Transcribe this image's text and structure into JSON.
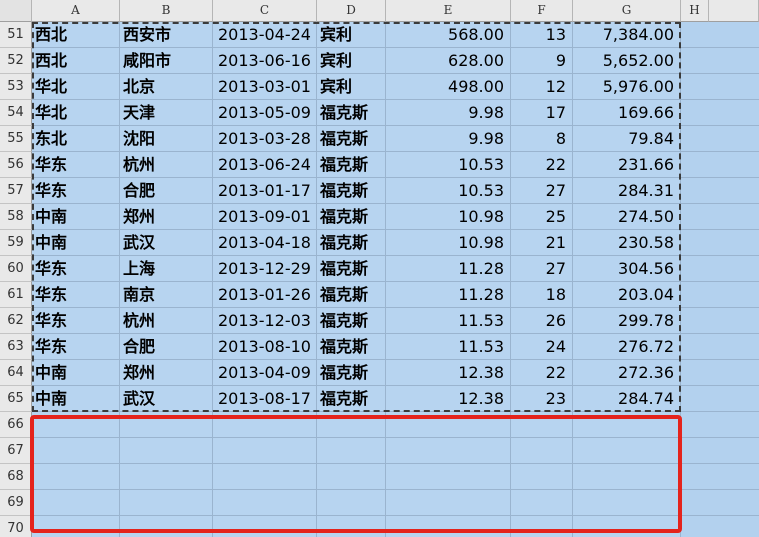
{
  "columns": [
    "A",
    "B",
    "C",
    "D",
    "E",
    "F",
    "G",
    "H"
  ],
  "rows": [
    {
      "num": "51",
      "region": "西北",
      "city": "西安市",
      "date": "2013-04-24",
      "brand": "宾利",
      "price": "568.00",
      "qty": "13",
      "total": "7,384.00"
    },
    {
      "num": "52",
      "region": "西北",
      "city": "咸阳市",
      "date": "2013-06-16",
      "brand": "宾利",
      "price": "628.00",
      "qty": "9",
      "total": "5,652.00"
    },
    {
      "num": "53",
      "region": "华北",
      "city": "北京",
      "date": "2013-03-01",
      "brand": "宾利",
      "price": "498.00",
      "qty": "12",
      "total": "5,976.00"
    },
    {
      "num": "54",
      "region": "华北",
      "city": "天津",
      "date": "2013-05-09",
      "brand": "福克斯",
      "price": "9.98",
      "qty": "17",
      "total": "169.66"
    },
    {
      "num": "55",
      "region": "东北",
      "city": "沈阳",
      "date": "2013-03-28",
      "brand": "福克斯",
      "price": "9.98",
      "qty": "8",
      "total": "79.84"
    },
    {
      "num": "56",
      "region": "华东",
      "city": "杭州",
      "date": "2013-06-24",
      "brand": "福克斯",
      "price": "10.53",
      "qty": "22",
      "total": "231.66"
    },
    {
      "num": "57",
      "region": "华东",
      "city": "合肥",
      "date": "2013-01-17",
      "brand": "福克斯",
      "price": "10.53",
      "qty": "27",
      "total": "284.31"
    },
    {
      "num": "58",
      "region": "中南",
      "city": "郑州",
      "date": "2013-09-01",
      "brand": "福克斯",
      "price": "10.98",
      "qty": "25",
      "total": "274.50"
    },
    {
      "num": "59",
      "region": "中南",
      "city": "武汉",
      "date": "2013-04-18",
      "brand": "福克斯",
      "price": "10.98",
      "qty": "21",
      "total": "230.58"
    },
    {
      "num": "60",
      "region": "华东",
      "city": "上海",
      "date": "2013-12-29",
      "brand": "福克斯",
      "price": "11.28",
      "qty": "27",
      "total": "304.56"
    },
    {
      "num": "61",
      "region": "华东",
      "city": "南京",
      "date": "2013-01-26",
      "brand": "福克斯",
      "price": "11.28",
      "qty": "18",
      "total": "203.04"
    },
    {
      "num": "62",
      "region": "华东",
      "city": "杭州",
      "date": "2013-12-03",
      "brand": "福克斯",
      "price": "11.53",
      "qty": "26",
      "total": "299.78"
    },
    {
      "num": "63",
      "region": "华东",
      "city": "合肥",
      "date": "2013-08-10",
      "brand": "福克斯",
      "price": "11.53",
      "qty": "24",
      "total": "276.72"
    },
    {
      "num": "64",
      "region": "中南",
      "city": "郑州",
      "date": "2013-04-09",
      "brand": "福克斯",
      "price": "12.38",
      "qty": "22",
      "total": "272.36"
    },
    {
      "num": "65",
      "region": "中南",
      "city": "武汉",
      "date": "2013-08-17",
      "brand": "福克斯",
      "price": "12.38",
      "qty": "23",
      "total": "284.74"
    }
  ],
  "empty_rows": [
    "66",
    "67",
    "68",
    "69",
    "70"
  ],
  "colors": {
    "selection_fill": "#b7d4f0",
    "highlight_border": "#e4231c",
    "marquee_border": "#3a3a3a"
  }
}
